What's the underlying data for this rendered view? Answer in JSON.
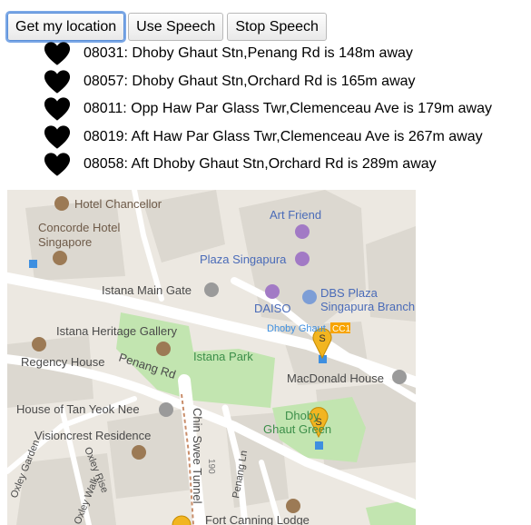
{
  "toolbar": {
    "get_location_label": "Get my location",
    "use_speech_label": "Use Speech",
    "stop_speech_label": "Stop Speech"
  },
  "stops": [
    {
      "text": "08031: Dhoby Ghaut Stn,Penang Rd is 148m away"
    },
    {
      "text": "08057: Dhoby Ghaut Stn,Orchard Rd is 165m away"
    },
    {
      "text": "08011: Opp Haw Par Glass Twr,Clemenceau Ave is 179m away"
    },
    {
      "text": "08019: Aft Haw Par Glass Twr,Clemenceau Ave is 267m away"
    },
    {
      "text": "08058: Aft Dhoby Ghaut Stn,Orchard Rd is 289m away"
    }
  ],
  "map": {
    "labels": {
      "hotel_chancellor": "Hotel Chancellor",
      "concorde_1": "Concorde Hotel",
      "concorde_2": "Singapore",
      "art_friend": "Art Friend",
      "plaza_singapura": "Plaza Singapura",
      "istana_main_gate": "Istana Main Gate",
      "daiso": "DAISO",
      "dbs_1": "DBS Plaza",
      "dbs_2": "Singapura Branch",
      "dhoby_ghaut": "Dhoby Ghaut",
      "cc1": "CC1",
      "istana_heritage": "Istana Heritage Gallery",
      "regency_house": "Regency House",
      "penang_rd": "Penang Rd",
      "istana_park": "Istana Park",
      "macdonald_house": "MacDonald House",
      "house_tan": "House of Tan Yeok Nee",
      "dhoby_green_1": "Dhoby",
      "dhoby_green_2": "Ghaut Green",
      "visioncrest": "Visioncrest Residence",
      "oxley_garden": "Oxley Garden",
      "oxley_rise": "Oxley Rise",
      "oxley_walk": "Oxley Walk",
      "chin_swee": "Chin Swee Tunnel",
      "penang_ln": "Penang Ln",
      "num_190": "190",
      "fort_canning": "Fort Canning Lodge",
      "marker_letter": "S"
    }
  }
}
